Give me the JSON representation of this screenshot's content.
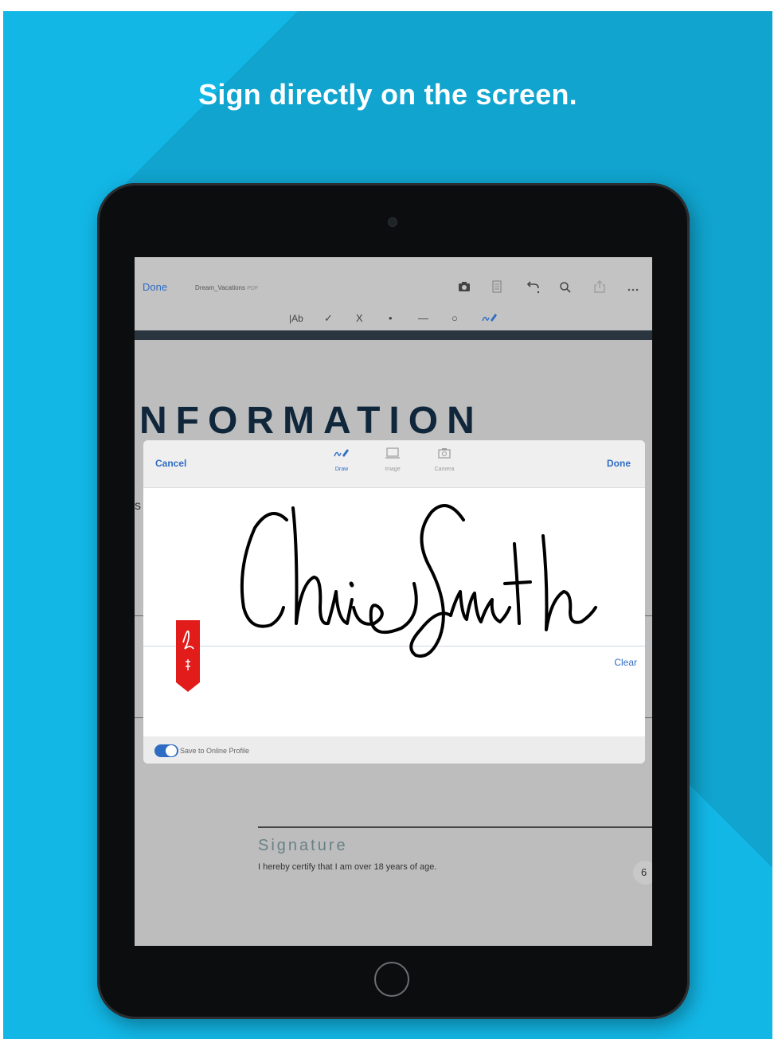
{
  "headline": "Sign directly on the screen.",
  "app_bar": {
    "done_label": "Done",
    "file_name": "Dream_Vacations",
    "file_ext": "PDF",
    "icons": [
      "camera-icon",
      "pages-icon",
      "undo-icon",
      "search-icon",
      "share-icon",
      "more-icon"
    ]
  },
  "toolbar": {
    "items": [
      "|Ab",
      "✓",
      "X",
      "•",
      "—",
      "○",
      "signature"
    ]
  },
  "document": {
    "heading": "NFORMATION",
    "stray_letter": "s",
    "signature_title": "Signature",
    "signature_desc": "I hereby certify that I am over 18 years of age.",
    "page_number": "6"
  },
  "signature_dialog": {
    "cancel_label": "Cancel",
    "done_label": "Done",
    "tabs": [
      {
        "label": "Draw",
        "icon": "pen-signature-icon",
        "active": true
      },
      {
        "label": "Image",
        "icon": "image-icon",
        "active": false
      },
      {
        "label": "Camera",
        "icon": "camera-icon",
        "active": false
      }
    ],
    "clear_label": "Clear",
    "signature_text": "Chris Smith",
    "save_toggle": {
      "label": "Save to Online Profile",
      "on": true
    }
  },
  "colors": {
    "background": "#12b7e6",
    "accent_blue": "#2f6cc4",
    "heading_dark": "#10263a",
    "acrobat_red": "#e21b1b"
  }
}
